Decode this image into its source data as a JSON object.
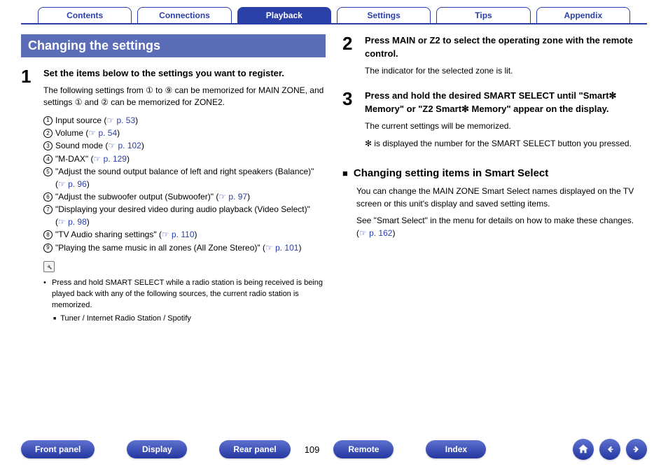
{
  "tabs": [
    "Contents",
    "Connections",
    "Playback",
    "Settings",
    "Tips",
    "Appendix"
  ],
  "activeTab": 2,
  "left": {
    "title": "Changing the settings",
    "step1": {
      "num": "1",
      "head": "Set the items below to the settings you want to register.",
      "desc": "The following settings from ① to ⑨ can be memorized for MAIN ZONE, and settings ① and ② can be memorized for ZONE2.",
      "items": [
        {
          "n": "1",
          "text": "Input source  (",
          "link": "p. 53",
          "after": ")"
        },
        {
          "n": "2",
          "text": "Volume  (",
          "link": "p. 54",
          "after": ")"
        },
        {
          "n": "3",
          "text": "Sound mode  (",
          "link": "p. 102",
          "after": ")"
        },
        {
          "n": "4",
          "text": "\"M-DAX\" (",
          "link": "p. 129",
          "after": ")"
        },
        {
          "n": "5",
          "text": "\"Adjust the sound output balance of left and right speakers (Balance)\" (",
          "link": "p. 96",
          "after": ")"
        },
        {
          "n": "6",
          "text": "\"Adjust the subwoofer output (Subwoofer)\" (",
          "link": "p. 97",
          "after": ")"
        },
        {
          "n": "7",
          "text": "\"Displaying your desired video during audio playback (Video Select)\" (",
          "link": "p. 98",
          "after": ")"
        },
        {
          "n": "8",
          "text": "\"TV Audio sharing settings\" (",
          "link": "p. 110",
          "after": ")"
        },
        {
          "n": "9",
          "text": "\"Playing the same music in all zones (All Zone Stereo)\" (",
          "link": "p. 101",
          "after": ")"
        }
      ],
      "note1": "Press and hold SMART SELECT while a radio station is being received is being played back with any of the following sources, the current radio station is memorized.",
      "note2": "Tuner / Internet Radio Station / Spotify"
    }
  },
  "right": {
    "step2": {
      "num": "2",
      "head": "Press MAIN or Z2 to select the operating zone with the remote control.",
      "desc": "The indicator for the selected zone is lit."
    },
    "step3": {
      "num": "3",
      "head": "Press and hold the desired SMART SELECT until \"Smart✻ Memory\" or \"Z2 Smart✻ Memory\" appear on the display.",
      "desc1": "The current settings will be memorized.",
      "desc2": "✻ is displayed the number for the SMART SELECT button you pressed."
    },
    "sub": {
      "title": "Changing setting items in Smart Select",
      "p1": "You can change the MAIN ZONE Smart Select names displayed on the TV screen or this unit's display and saved setting items.",
      "p2a": "See \"Smart Select\" in the menu for details on how to make these changes.  (",
      "p2link": "p. 162",
      "p2b": ")"
    }
  },
  "footer": {
    "pills": [
      "Front panel",
      "Display",
      "Rear panel"
    ],
    "page": "109",
    "pills2": [
      "Remote",
      "Index"
    ]
  }
}
